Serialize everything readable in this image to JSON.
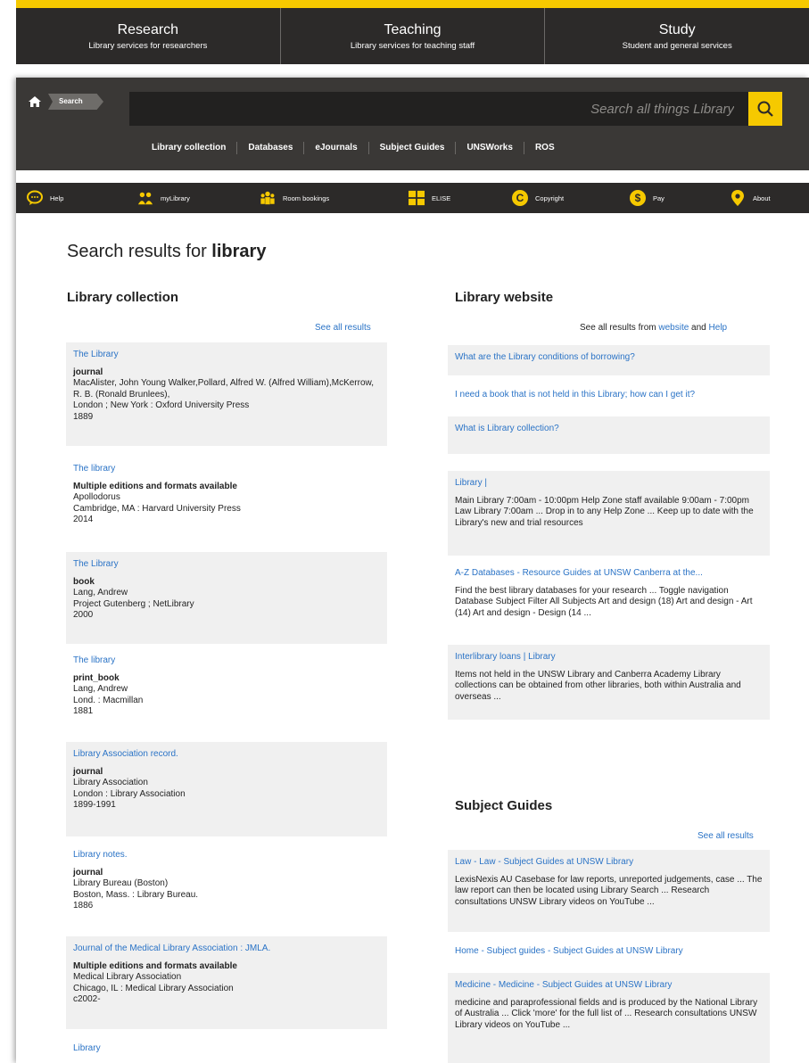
{
  "topnav": [
    {
      "title": "Research",
      "sub": "Library services for researchers"
    },
    {
      "title": "Teaching",
      "sub": "Library services for teaching staff"
    },
    {
      "title": "Study",
      "sub": "Student and general services"
    }
  ],
  "breadcrumb": "Search",
  "search": {
    "placeholder": "Search all things Library"
  },
  "sublinks": [
    "Library collection",
    "Databases",
    "eJournals",
    "Subject Guides",
    "UNSWorks",
    "ROS"
  ],
  "iconbar": [
    {
      "label": "Help",
      "icon": "chat-bubble-icon"
    },
    {
      "label": "myLibrary",
      "icon": "people-icon"
    },
    {
      "label": "Room bookings",
      "icon": "group-icon"
    },
    {
      "label": "ELISE",
      "icon": "grid-icon"
    },
    {
      "label": "Copyright",
      "icon": "copyright-icon"
    },
    {
      "label": "Pay",
      "icon": "dollar-icon"
    },
    {
      "label": "About",
      "icon": "location-pin-icon"
    }
  ],
  "results_heading": {
    "prefix": "Search results for ",
    "query": "library"
  },
  "collection": {
    "title": "Library collection",
    "see_all": "See all results",
    "items": [
      {
        "title": "The Library",
        "type": "journal",
        "lines": [
          "MacAlister, John Young Walker,Pollard, Alfred W. (Alfred William),McKerrow, R. B. (Ronald Brunlees),",
          "London ; New York : Oxford University Press",
          "1889"
        ]
      },
      {
        "title": "The library",
        "type": "Multiple editions and formats available",
        "lines": [
          "Apollodorus",
          "Cambridge, MA : Harvard University Press",
          "2014"
        ]
      },
      {
        "title": "The Library",
        "type": "book",
        "lines": [
          "Lang, Andrew",
          "Project Gutenberg ; NetLibrary",
          "2000"
        ]
      },
      {
        "title": "The library",
        "type": "print_book",
        "lines": [
          "Lang, Andrew",
          "Lond. : Macmillan",
          "1881"
        ]
      },
      {
        "title": "Library Association record.",
        "type": "journal",
        "lines": [
          "Library Association",
          "London : Library Association",
          "1899-1991"
        ]
      },
      {
        "title": "Library notes.",
        "type": "journal",
        "lines": [
          "Library Bureau (Boston)",
          "Boston, Mass. : Library Bureau.",
          "1886"
        ]
      },
      {
        "title": "Journal of the Medical Library Association : JMLA.",
        "type": "Multiple editions and formats available",
        "lines": [
          "Medical Library Association",
          "Chicago, IL : Medical Library Association",
          "c2002-"
        ]
      },
      {
        "title": "Library",
        "type": "",
        "lines": []
      }
    ]
  },
  "website": {
    "title": "Library website",
    "see_all_prefix": "See all results from ",
    "see_all_link1": "website",
    "see_all_mid": " and ",
    "see_all_link2": "Help",
    "faq": [
      "What are the Library conditions of borrowing?",
      "I need a book that is not held in this Library; how can I get it?",
      "What is Library collection?"
    ],
    "pages": [
      {
        "title": "Library |",
        "desc": "Main Library 7:00am - 10:00pm Help Zone staff available 9:00am - 7:00pm Law Library 7:00am ... Drop in to any Help Zone ... Keep up to date with the Library's new and trial resources"
      },
      {
        "title": "A-Z Databases - Resource Guides at UNSW Canberra at the...",
        "desc": "Find the best library databases for your research ... Toggle navigation Database Subject Filter All Subjects Art and design (18) Art and design - Art (14) Art and design - Design (14 ..."
      },
      {
        "title": "Interlibrary loans | Library",
        "desc": "Items not held in the UNSW Library and Canberra Academy Library collections can be obtained from other libraries, both within Australia and overseas ..."
      }
    ]
  },
  "guides": {
    "title": "Subject Guides",
    "see_all": "See all results",
    "items": [
      {
        "title": "Law - Law - Subject Guides at UNSW Library",
        "desc": "LexisNexis AU Casebase for law reports, unreported judgements, case ... The law report can then be located using Library Search ... Research consultations UNSW Library videos on YouTube ..."
      },
      {
        "title": "Home - Subject guides - Subject Guides at UNSW Library",
        "desc": ""
      },
      {
        "title": "Medicine - Medicine - Subject Guides at UNSW Library",
        "desc": "medicine and paraprofessional fields and is produced by the National Library of Australia ... Click 'more' for the full list of ... Research consultations UNSW Library videos on YouTube ..."
      }
    ]
  },
  "colors": {
    "accent": "#f6c900",
    "dark": "#2c2a29",
    "link": "#2a73c6"
  }
}
